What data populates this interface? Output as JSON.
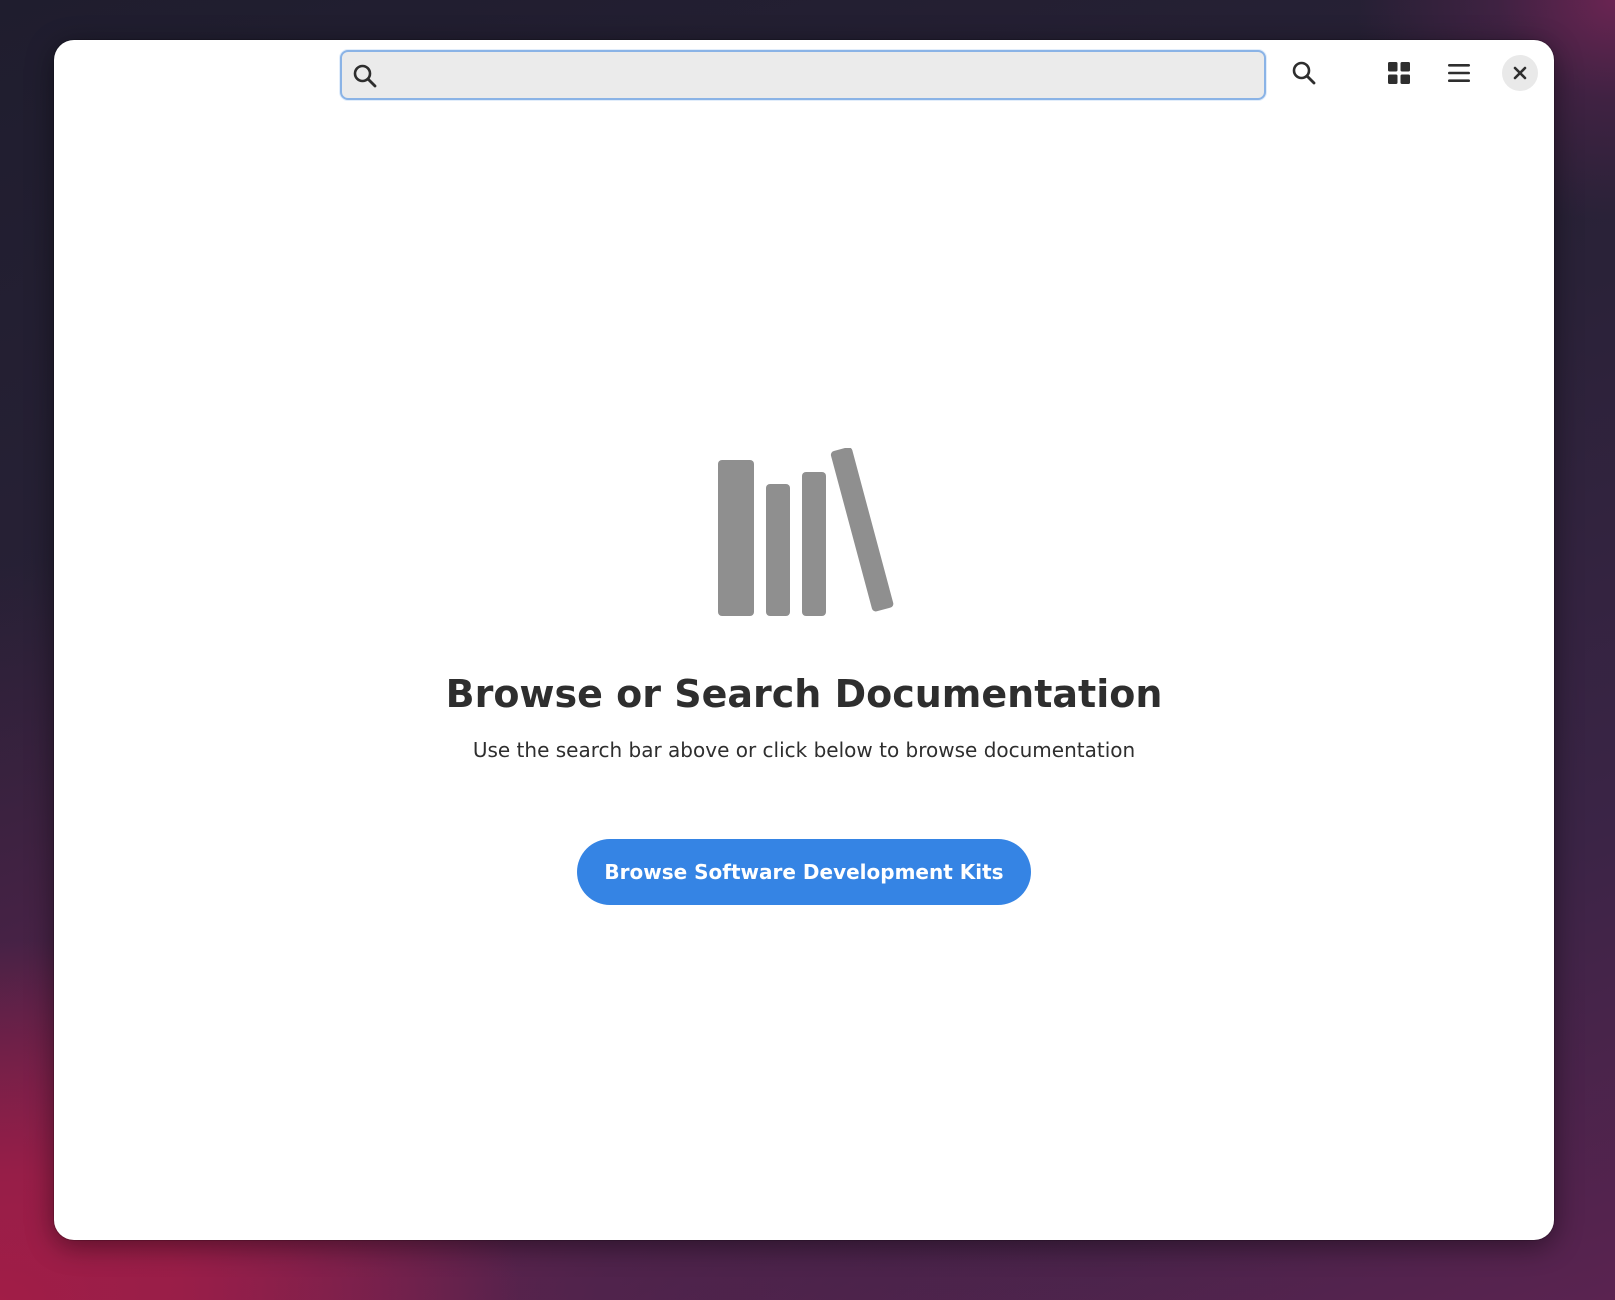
{
  "search": {
    "value": "",
    "placeholder": ""
  },
  "headerbar": {
    "icons": [
      "search-icon",
      "grid-icon",
      "hamburger-menu-icon",
      "close-icon"
    ]
  },
  "status_page": {
    "icon": "books-icon",
    "title": "Browse or Search Documentation",
    "description": "Use the search bar above or click below to browse documentation",
    "button_label": "Browse Software Development Kits"
  },
  "colors": {
    "accent": "#3584e4",
    "icon_gray": "#8f8f8f",
    "text": "#2e2e2e",
    "entry_focus_border": "#8ab3e6"
  }
}
